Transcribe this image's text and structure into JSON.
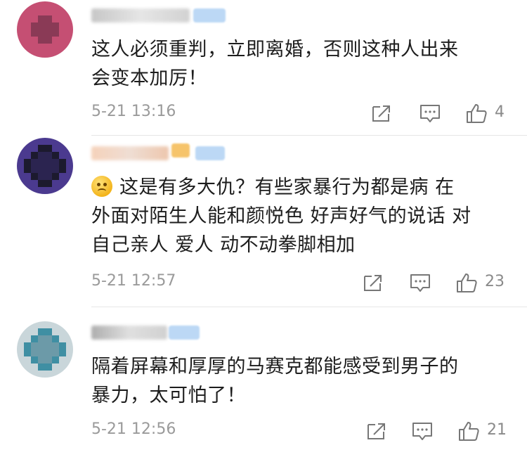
{
  "comments": [
    {
      "text_line1": "这人必须重判，立即离婚，否则这种人出来",
      "text_line2": "会变本加厉！",
      "time": "5-21 13:16",
      "likes": "4",
      "colors": {
        "avatar": [
          "#c54f73",
          "#8a3a56",
          "#e7a8b8",
          "#5b3040"
        ]
      }
    },
    {
      "text_line1": "这是有多大仇？有些家暴行为都是病 在",
      "text_line2": "外面对陌生人能和颜悦色 好声好气的说话 对",
      "text_line3": "自己亲人 爱人 动不动拳脚相加",
      "time": "5-21 12:57",
      "likes": "23",
      "colors": {
        "avatar": [
          "#4b3a8f",
          "#2b2450",
          "#7a6bbf",
          "#1c1a2e"
        ]
      }
    },
    {
      "text_line1": "隔着屏幕和厚厚的马赛克都能感受到男子的",
      "text_line2": "暴力，太可怕了！",
      "time": "5-21 12:56",
      "likes": "21",
      "colors": {
        "avatar": [
          "#3f8fa3",
          "#6c9aa8",
          "#c9d6da",
          "#2f6b78"
        ]
      }
    }
  ],
  "icons": {
    "share": "share-icon",
    "comment": "comment-icon",
    "like": "thumbs-up-icon",
    "emoji": "upside-down-smile-emoji-icon"
  }
}
